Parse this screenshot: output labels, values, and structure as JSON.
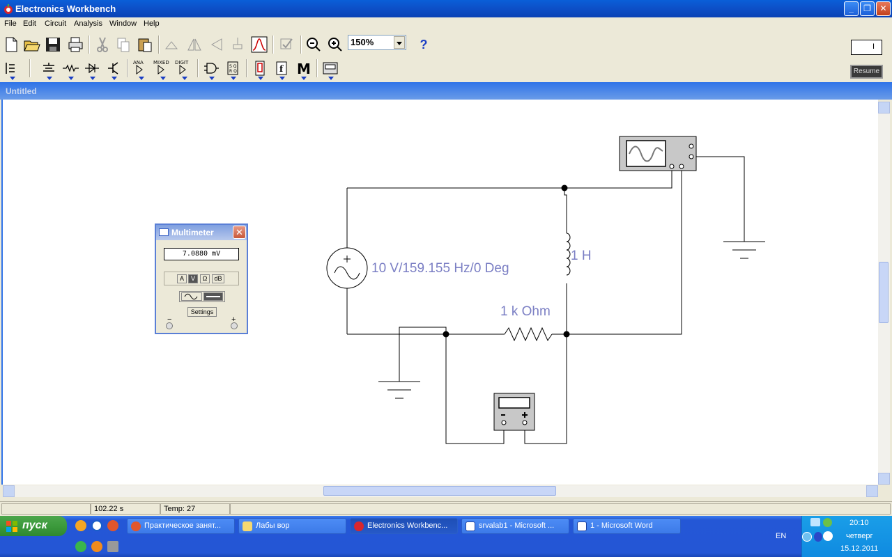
{
  "window": {
    "title": "Electronics Workbench"
  },
  "menu": [
    "File",
    "Edit",
    "Circuit",
    "Analysis",
    "Window",
    "Help"
  ],
  "toolbar": {
    "zoom": "150%",
    "help": "?",
    "resume": "Resume",
    "hw_label": "I"
  },
  "child": {
    "title": "Untitled"
  },
  "multimeter": {
    "title": "Multimeter",
    "reading": "7.0880  mV",
    "modes": [
      "A",
      "V",
      "Ω",
      "dB"
    ],
    "selected_mode": "V",
    "settings_label": "Settings",
    "minus": "−",
    "plus": "+"
  },
  "circuit": {
    "source_label": "10 V/159.155 Hz/0 Deg",
    "inductor_label": "1 H",
    "resistor_label": "1 k Ohm",
    "meter_minus": "−",
    "meter_plus": "+"
  },
  "status": {
    "time": "102.22 s",
    "temp": "Temp:  27"
  },
  "taskbar": {
    "start": "пуск",
    "tasks": [
      {
        "label": "Практическое занят..."
      },
      {
        "label": "Лабы вор"
      },
      {
        "label": "Electronics Workbenc..."
      },
      {
        "label": "srvalab1 - Microsoft ..."
      },
      {
        "label": "1 - Microsoft Word"
      }
    ],
    "lang": "EN",
    "clock": "20:10",
    "day": "четверг",
    "date": "15.12.2011"
  }
}
